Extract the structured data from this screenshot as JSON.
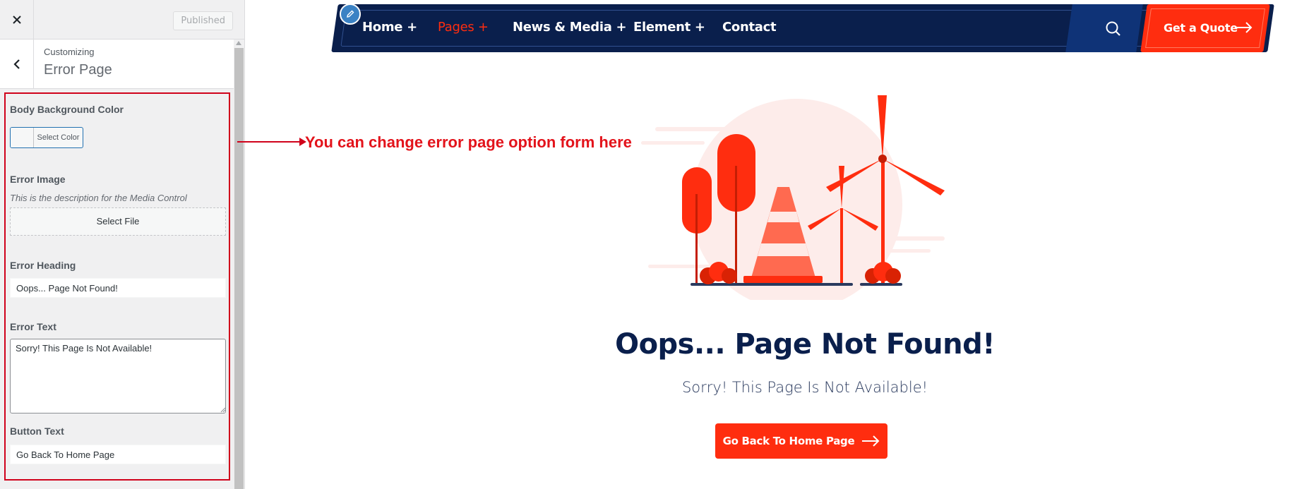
{
  "customizer": {
    "close_icon": "close-icon",
    "published_label": "Published",
    "customizing_label": "Customizing",
    "section_name": "Error Page",
    "controls": {
      "bg_color_label": "Body Background Color",
      "select_color_label": "Select Color",
      "error_image_label": "Error Image",
      "media_description": "This is the description for the Media Control",
      "select_file_label": "Select File",
      "error_heading_label": "Error Heading",
      "error_heading_value": "Oops... Page Not Found!",
      "error_text_label": "Error Text",
      "error_text_value": "Sorry! This Page Is Not Available!",
      "button_text_label": "Button Text",
      "button_text_value": "Go Back To Home Page"
    }
  },
  "annotation": {
    "text": "You can change error page option form here",
    "color": "#d0021b"
  },
  "site": {
    "nav": {
      "items": [
        {
          "label": "Home +"
        },
        {
          "label": "Pages +"
        },
        {
          "label": "News & Media +"
        },
        {
          "label": "Element +"
        },
        {
          "label": "Contact"
        }
      ],
      "cta_label": "Get a Quote"
    },
    "error": {
      "heading": "Oops... Page Not Found!",
      "subtext": "Sorry! This Page Is Not Available!",
      "button_label": "Go Back To Home Page"
    },
    "colors": {
      "navy": "#0a1f4c",
      "accent": "#ff2d0f",
      "soft_pink": "#fdecea"
    }
  }
}
